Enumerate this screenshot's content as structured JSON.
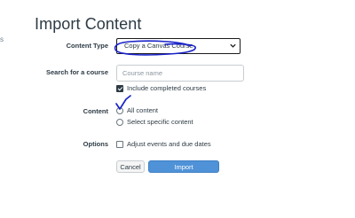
{
  "edge_mark": "s",
  "page": {
    "title": "Import Content"
  },
  "content_type": {
    "label": "Content Type",
    "selected": "Copy a Canvas Course"
  },
  "search_course": {
    "label": "Search for a course",
    "placeholder": "Course name",
    "include_completed_label": "Include completed courses",
    "include_completed_checked": true
  },
  "content": {
    "label": "Content",
    "options": [
      {
        "label": "All content"
      },
      {
        "label": "Select specific content"
      }
    ]
  },
  "options": {
    "label": "Options",
    "adjust_dates_label": "Adjust events and due dates",
    "adjust_dates_checked": false
  },
  "buttons": {
    "cancel": "Cancel",
    "import": "Import"
  },
  "colors": {
    "import_button": "#4f92d8",
    "pen_annotation": "#1a23c9"
  }
}
